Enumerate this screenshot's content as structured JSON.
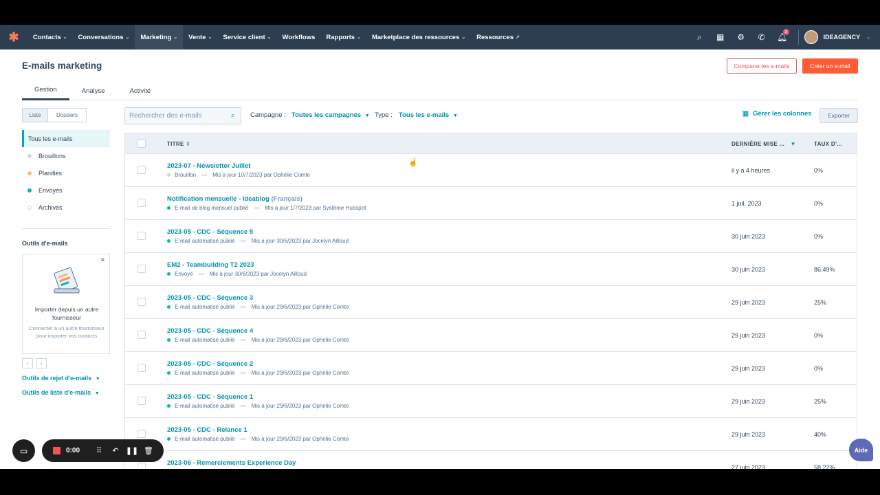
{
  "nav": {
    "items": [
      {
        "label": "Contacts",
        "caret": true
      },
      {
        "label": "Conversations",
        "caret": true
      },
      {
        "label": "Marketing",
        "caret": true,
        "active": true
      },
      {
        "label": "Vente",
        "caret": true
      },
      {
        "label": "Service client",
        "caret": true
      },
      {
        "label": "Workflows",
        "caret": false
      },
      {
        "label": "Rapports",
        "caret": true
      },
      {
        "label": "Marketplace des ressources",
        "caret": true
      },
      {
        "label": "Ressources",
        "caret": false,
        "external": true
      }
    ],
    "notification_count": "3",
    "account": "IDEAGENCY"
  },
  "header": {
    "title": "E-mails marketing",
    "compare_label": "Comparer les e-mails",
    "create_label": "Créer un e-mail"
  },
  "tabs": [
    "Gestion",
    "Analyse",
    "Activité"
  ],
  "sidebar": {
    "toggle": [
      "Liste",
      "Dossiers"
    ],
    "items": [
      {
        "label": "Tous les e-mails",
        "dot": ""
      },
      {
        "label": "Brouillons",
        "dot": "#cbd6e2"
      },
      {
        "label": "Planifiés",
        "dot": "#f5c26b"
      },
      {
        "label": "Envoyés",
        "dot": "#00bda5"
      },
      {
        "label": "Archivés",
        "dot": "ring"
      }
    ],
    "tools_title": "Outils d'e-mails",
    "card_title": "Importer depuis un autre fournisseur",
    "card_desc": "Connecter à un autre fournisseur pour importer vos contacts",
    "links": [
      "Outils de rejet d'e-mails",
      "Outils de liste d'e-mails"
    ]
  },
  "filters": {
    "search_placeholder": "Rechercher des e-mails",
    "campaign_label": "Campagne :",
    "campaign_value": "Toutes les campagnes",
    "type_label": "Type :",
    "type_value": "Tous les e-mails",
    "columns_label": "Gérer les colonnes",
    "export_label": "Exporter"
  },
  "table": {
    "columns": [
      "TITRE",
      "DERNIÈRE MISE ...",
      "TAUX D'..."
    ],
    "rows": [
      {
        "title": "2023-07 - Newsletter Juillet",
        "lang": "",
        "status": "Brouillon",
        "status_color": "#cbd6e2",
        "updated": "Mis à jour 10/7/2023 par Ophélie Comte",
        "date": "il y a 4 heures",
        "rate": "0%"
      },
      {
        "title": "Notification mensuelle - Ideablog",
        "lang": "(Français)",
        "status": "E-mail de blog mensuel publié",
        "status_color": "#00bda5",
        "updated": "Mis à jour 1/7/2023 par Système Hubspot",
        "date": "1 juil. 2023",
        "rate": "0%"
      },
      {
        "title": "2023-05 - CDC - Séquence 5",
        "lang": "",
        "status": "E-mail automatisé publié",
        "status_color": "#00bda5",
        "updated": "Mis à jour 30/6/2023 par Jocelyn Ailloud",
        "date": "30 juin 2023",
        "rate": "0%"
      },
      {
        "title": "EM2 - Teambuilding T2 2023",
        "lang": "",
        "status": "Envoyé",
        "status_color": "#00bda5",
        "updated": "Mis à jour 30/6/2023 par Jocelyn Ailloud",
        "date": "30 juin 2023",
        "rate": "86,49%"
      },
      {
        "title": "2023-05 - CDC - Séquence 3",
        "lang": "",
        "status": "E-mail automatisé publié",
        "status_color": "#00bda5",
        "updated": "Mis à jour 29/6/2023 par Ophélie Comte",
        "date": "29 juin 2023",
        "rate": "25%"
      },
      {
        "title": "2023-05 - CDC - Séquence 4",
        "lang": "",
        "status": "E-mail automatisé publié",
        "status_color": "#00bda5",
        "updated": "Mis à jour 29/6/2023 par Ophélie Comte",
        "date": "29 juin 2023",
        "rate": "0%"
      },
      {
        "title": "2023-05 - CDC - Séquence 2",
        "lang": "",
        "status": "E-mail automatisé publié",
        "status_color": "#00bda5",
        "updated": "Mis à jour 29/6/2023 par Ophélie Comte",
        "date": "29 juin 2023",
        "rate": "0%"
      },
      {
        "title": "2023-05 - CDC - Séquence 1",
        "lang": "",
        "status": "E-mail automatisé publié",
        "status_color": "#00bda5",
        "updated": "Mis à jour 29/6/2023 par Ophélie Comte",
        "date": "29 juin 2023",
        "rate": "25%"
      },
      {
        "title": "2023-05 - CDC - Relance 1",
        "lang": "",
        "status": "E-mail automatisé publié",
        "status_color": "#00bda5",
        "updated": "Mis à jour 29/6/2023 par Ophélie Comte",
        "date": "29 juin 2023",
        "rate": "40%"
      },
      {
        "title": "2023-06 - Remerciements Experience Day",
        "lang": "",
        "status": "",
        "status_color": "#00bda5",
        "updated": "",
        "date": "27 juin 2023",
        "rate": "58,22%"
      }
    ]
  },
  "recorder": {
    "time": "0:00"
  },
  "help_label": "Aide",
  "colors": {
    "nav_bg": "#2d3e50",
    "accent": "#0091ae",
    "cta": "#ff5c35"
  }
}
